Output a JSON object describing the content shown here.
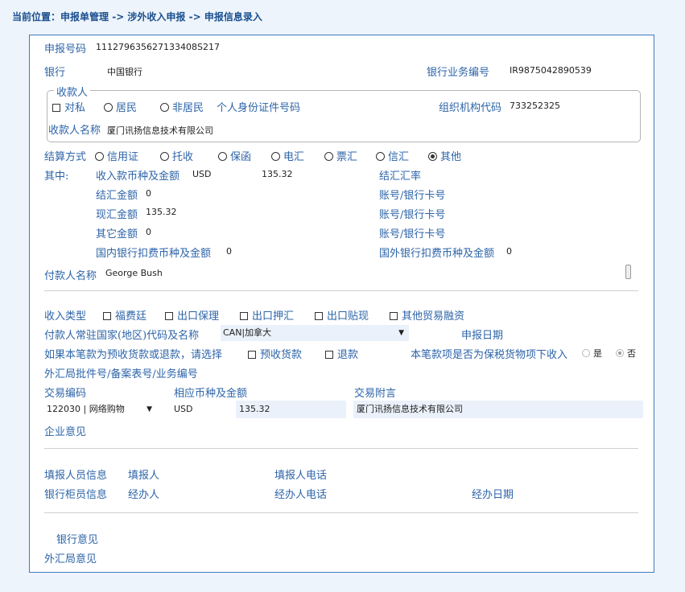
{
  "breadcrumb": {
    "prefix": "当前位置：",
    "l1": "申报单管理",
    "sep1": " -> ",
    "l2": "涉外收入申报",
    "sep2": " -> ",
    "l3": "申报信息录入"
  },
  "decl": {
    "label": "申报号码",
    "value": "111279635627133408S217"
  },
  "bank": {
    "label": "银行",
    "value": "中国银行",
    "biz_label": "银行业务编号",
    "biz_value": "IR9875042890539"
  },
  "payee": {
    "legend": "收款人",
    "private": "对私",
    "resident": "居民",
    "nonresident": "非居民",
    "id_label": "个人身份证件号码",
    "org_label": "组织机构代码",
    "org_value": "733252325",
    "name_label": "收款人名称",
    "name_value": "厦门讯扬信息技术有限公司"
  },
  "settle": {
    "label": "结算方式",
    "options": [
      "信用证",
      "托收",
      "保函",
      "电汇",
      "票汇",
      "信汇",
      "其他"
    ],
    "selected": "其他"
  },
  "amounts": {
    "qizhong": "其中:",
    "income_label": "收入款币种及金额",
    "income_currency": "USD",
    "income_amount": "135.32",
    "rate_label": "结汇汇率",
    "settle_label": "结汇金额",
    "settle_value": "0",
    "spot_label": "现汇金额",
    "spot_value": "135.32",
    "other_label": "其它金额",
    "other_value": "0",
    "account_label": "账号/银行卡号",
    "dom_fee_label": "国内银行扣费币种及金额",
    "dom_fee_value": "0",
    "for_fee_label": "国外银行扣费币种及金额",
    "for_fee_value": "0"
  },
  "payer": {
    "label": "付款人名称",
    "value": "George Bush"
  },
  "income_type": {
    "label": "收入类型",
    "options": [
      "福费廷",
      "出口保理",
      "出口押汇",
      "出口贴现",
      "其他贸易融资"
    ]
  },
  "country": {
    "label": "付款人常驻国家(地区)代码及名称",
    "value": "CAN|加拿大",
    "date_label": "申报日期"
  },
  "prepay": {
    "label": "如果本笔款为预收货款或退款，请选择",
    "opt1": "预收货款",
    "opt2": "退款",
    "bonded_label": "本笔款项是否为保税货物项下收入",
    "yes": "是",
    "no": "否",
    "bonded_selected": "否"
  },
  "approval": {
    "label": "外汇局批件号/备案表号/业务编号"
  },
  "trade": {
    "code_label": "交易编码",
    "currency_label": "相应币种及金额",
    "note_label": "交易附言",
    "code_value": "122030 | 网络购物",
    "currency_value": "USD",
    "amount_value": "135.32",
    "note_value": "厦门讯扬信息技术有限公司"
  },
  "enterprise": {
    "label": "企业意见"
  },
  "filler": {
    "section": "填报人员信息",
    "name_label": "填报人",
    "phone_label": "填报人电话"
  },
  "counter": {
    "section": "银行柜员信息",
    "handler_label": "经办人",
    "phone_label": "经办人电话",
    "date_label": "经办日期"
  },
  "opinions": {
    "bank": "银行意见",
    "safe": "外汇局意见"
  }
}
